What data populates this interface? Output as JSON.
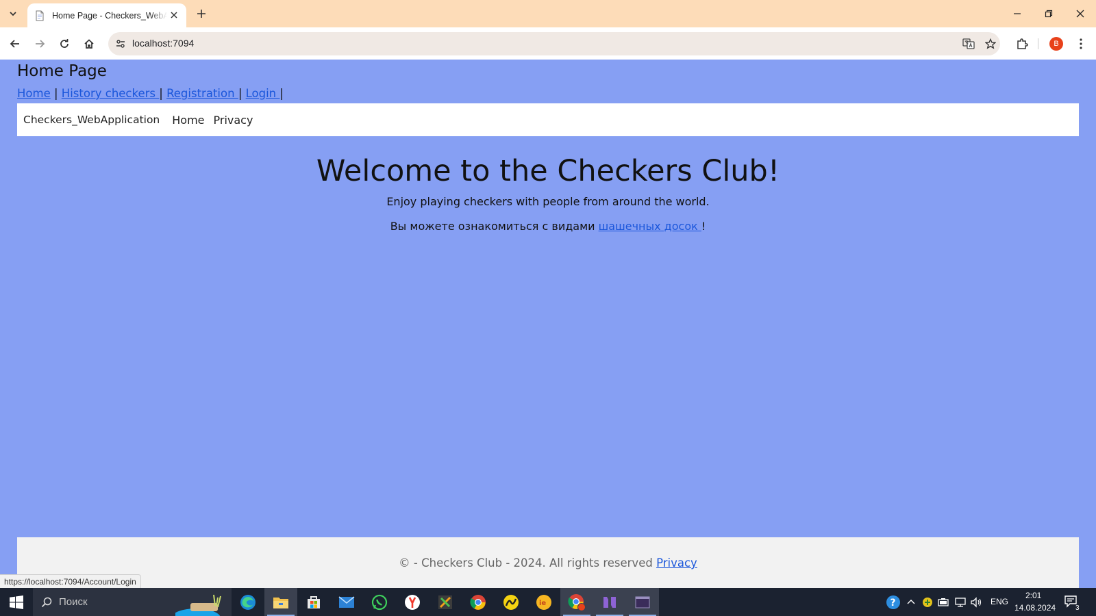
{
  "browser": {
    "tab_title": "Home Page - Checkers_WebApplication",
    "url": "localhost:7094",
    "profile_initial": "B",
    "status_url": "https://localhost:7094/Account/Login"
  },
  "page": {
    "heading": "Home Page",
    "top_links": [
      {
        "label": "Home"
      },
      {
        "label": "History checkers "
      },
      {
        "label": "Registration "
      },
      {
        "label": "Login "
      }
    ],
    "separator": "|",
    "navbar": {
      "brand": "Checkers_WebApplication",
      "links": [
        "Home",
        "Privacy"
      ]
    },
    "hero": {
      "title": "Welcome to the Checkers Club!",
      "subtitle": "Enjoy playing checkers with people from around the world.",
      "ru_text": "Вы можете ознакомиться с видами ",
      "ru_link": "шашечных досок ",
      "ru_suffix": "!"
    },
    "footer": {
      "text": "© - Checkers Club - 2024. All rights reserved ",
      "link": "Privacy"
    }
  },
  "taskbar": {
    "search_placeholder": "Поиск",
    "language": "ENG",
    "time": "2:01",
    "date": "14.08.2024",
    "notifications": "3"
  },
  "colors": {
    "page_bg": "#869ff3",
    "tabstrip_bg": "#fddcb8",
    "link": "#1a56db",
    "taskbar_bg": "#1b2230"
  }
}
